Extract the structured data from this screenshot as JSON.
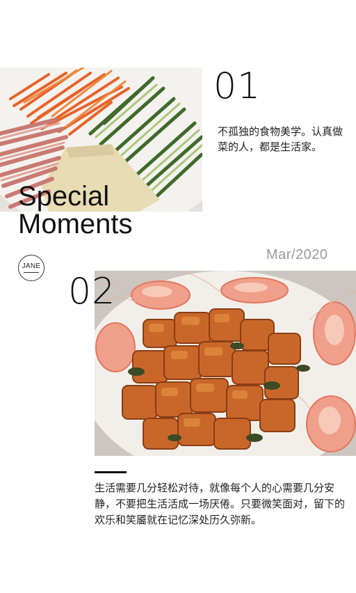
{
  "section1": {
    "number": "01",
    "caption": "不孤独的食物美学。认真做菜的人，都是生活家。"
  },
  "title": {
    "line1": "Special",
    "line2": "Moments"
  },
  "date": "Mar/2020",
  "logo": {
    "text": "JANE"
  },
  "section2": {
    "number": "02",
    "caption": "生活需要几分轻松对待，就像每个人的心需要几分安静，不要把生活活成一场厌倦。只要微笑面对，留下的欢乐和笑靥就在记忆深处历久弥新。"
  },
  "colors": {
    "text": "#111111",
    "date": "#9a9a9a",
    "background": "#ffffff"
  }
}
